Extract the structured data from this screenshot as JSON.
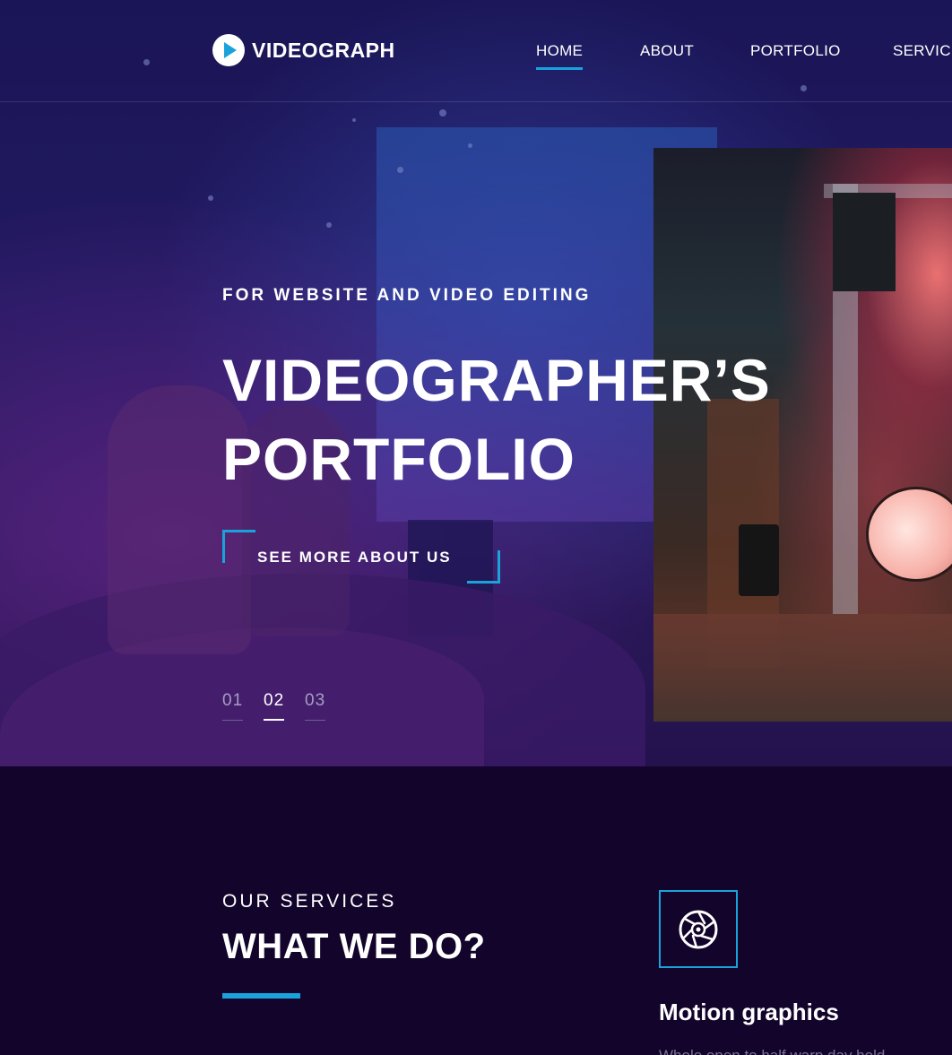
{
  "brand": {
    "name": "VIDEOGRAPH",
    "accent_color": "#1aa3db",
    "background_color": "#12042b"
  },
  "nav": {
    "items": [
      {
        "label": "HOME",
        "active": true
      },
      {
        "label": "ABOUT",
        "active": false
      },
      {
        "label": "PORTFOLIO",
        "active": false
      },
      {
        "label": "SERVICES",
        "active": false
      }
    ]
  },
  "hero": {
    "eyebrow": "FOR WEBSITE AND VIDEO EDITING",
    "title_line_1": "VIDEOGRAPHER’S",
    "title_line_2": "PORTFOLIO",
    "cta_label": "SEE MORE ABOUT US",
    "slides": [
      {
        "label": "01",
        "active": false
      },
      {
        "label": "02",
        "active": true
      },
      {
        "label": "03",
        "active": false
      }
    ]
  },
  "services": {
    "eyebrow": "OUR SERVICES",
    "title": "WHAT WE DO?",
    "items": [
      {
        "icon": "camera-aperture-icon",
        "title": "Motion graphics",
        "text": "Whole open to half warp day hold"
      }
    ]
  }
}
